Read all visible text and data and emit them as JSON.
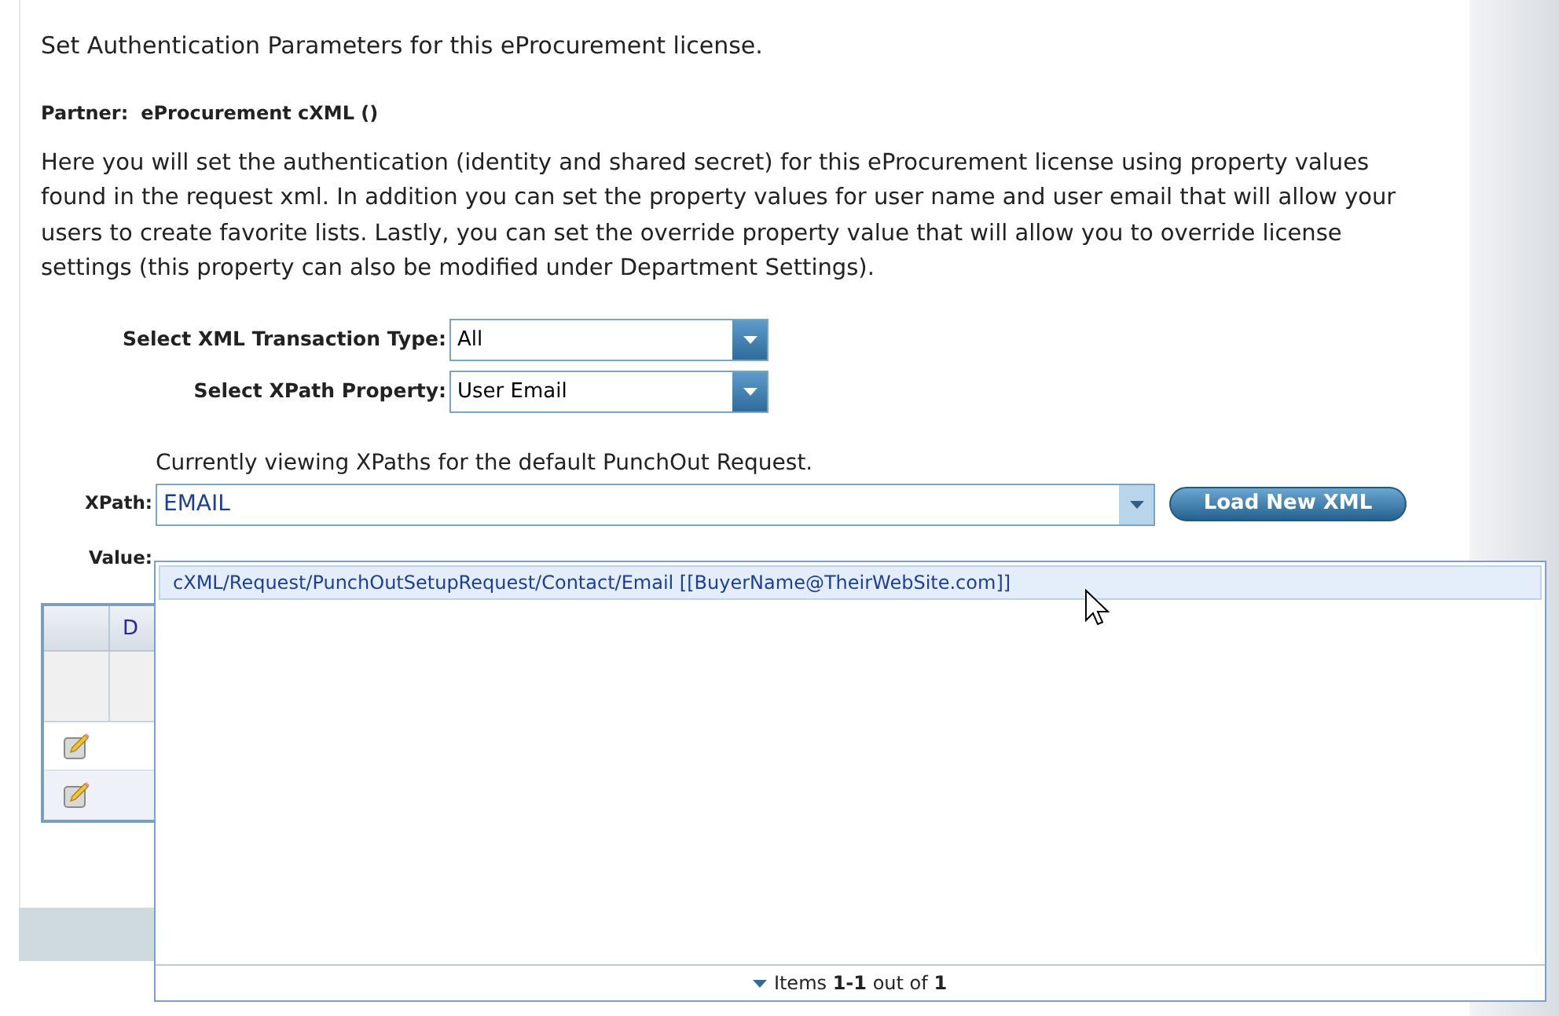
{
  "heading": "Set Authentication Parameters for this eProcurement license.",
  "partner": {
    "label": "Partner:",
    "value": "eProcurement cXML ()"
  },
  "description": "Here you will set the authentication (identity and shared secret) for this eProcurement license using property values found in the request xml. In addition you can set the property values for user name and user email that will allow your users to create favorite lists. Lastly, you can set the override property value that will allow you to override license settings (this property can also be modified under Department Settings).",
  "selects": [
    {
      "label": "Select XML Transaction Type:",
      "value": "All"
    },
    {
      "label": "Select XPath Property:",
      "value": "User Email"
    }
  ],
  "viewing_note": "Currently viewing XPaths for the default PunchOut Request.",
  "xpath": {
    "label": "XPath:",
    "value": "EMAIL",
    "button": "Load New XML",
    "expanded": true
  },
  "value_label": "Value:",
  "table": {
    "column_2": "D",
    "rows": [
      {
        "kind": "edit"
      },
      {
        "kind": "edit"
      }
    ]
  },
  "dropdown": {
    "items": [
      {
        "text": "cXML/Request/PunchOutSetupRequest/Contact/Email [[BuyerName@TheirWebSite.com]]",
        "selected": true
      }
    ],
    "footer": "Items **1-1** out of **1**"
  }
}
